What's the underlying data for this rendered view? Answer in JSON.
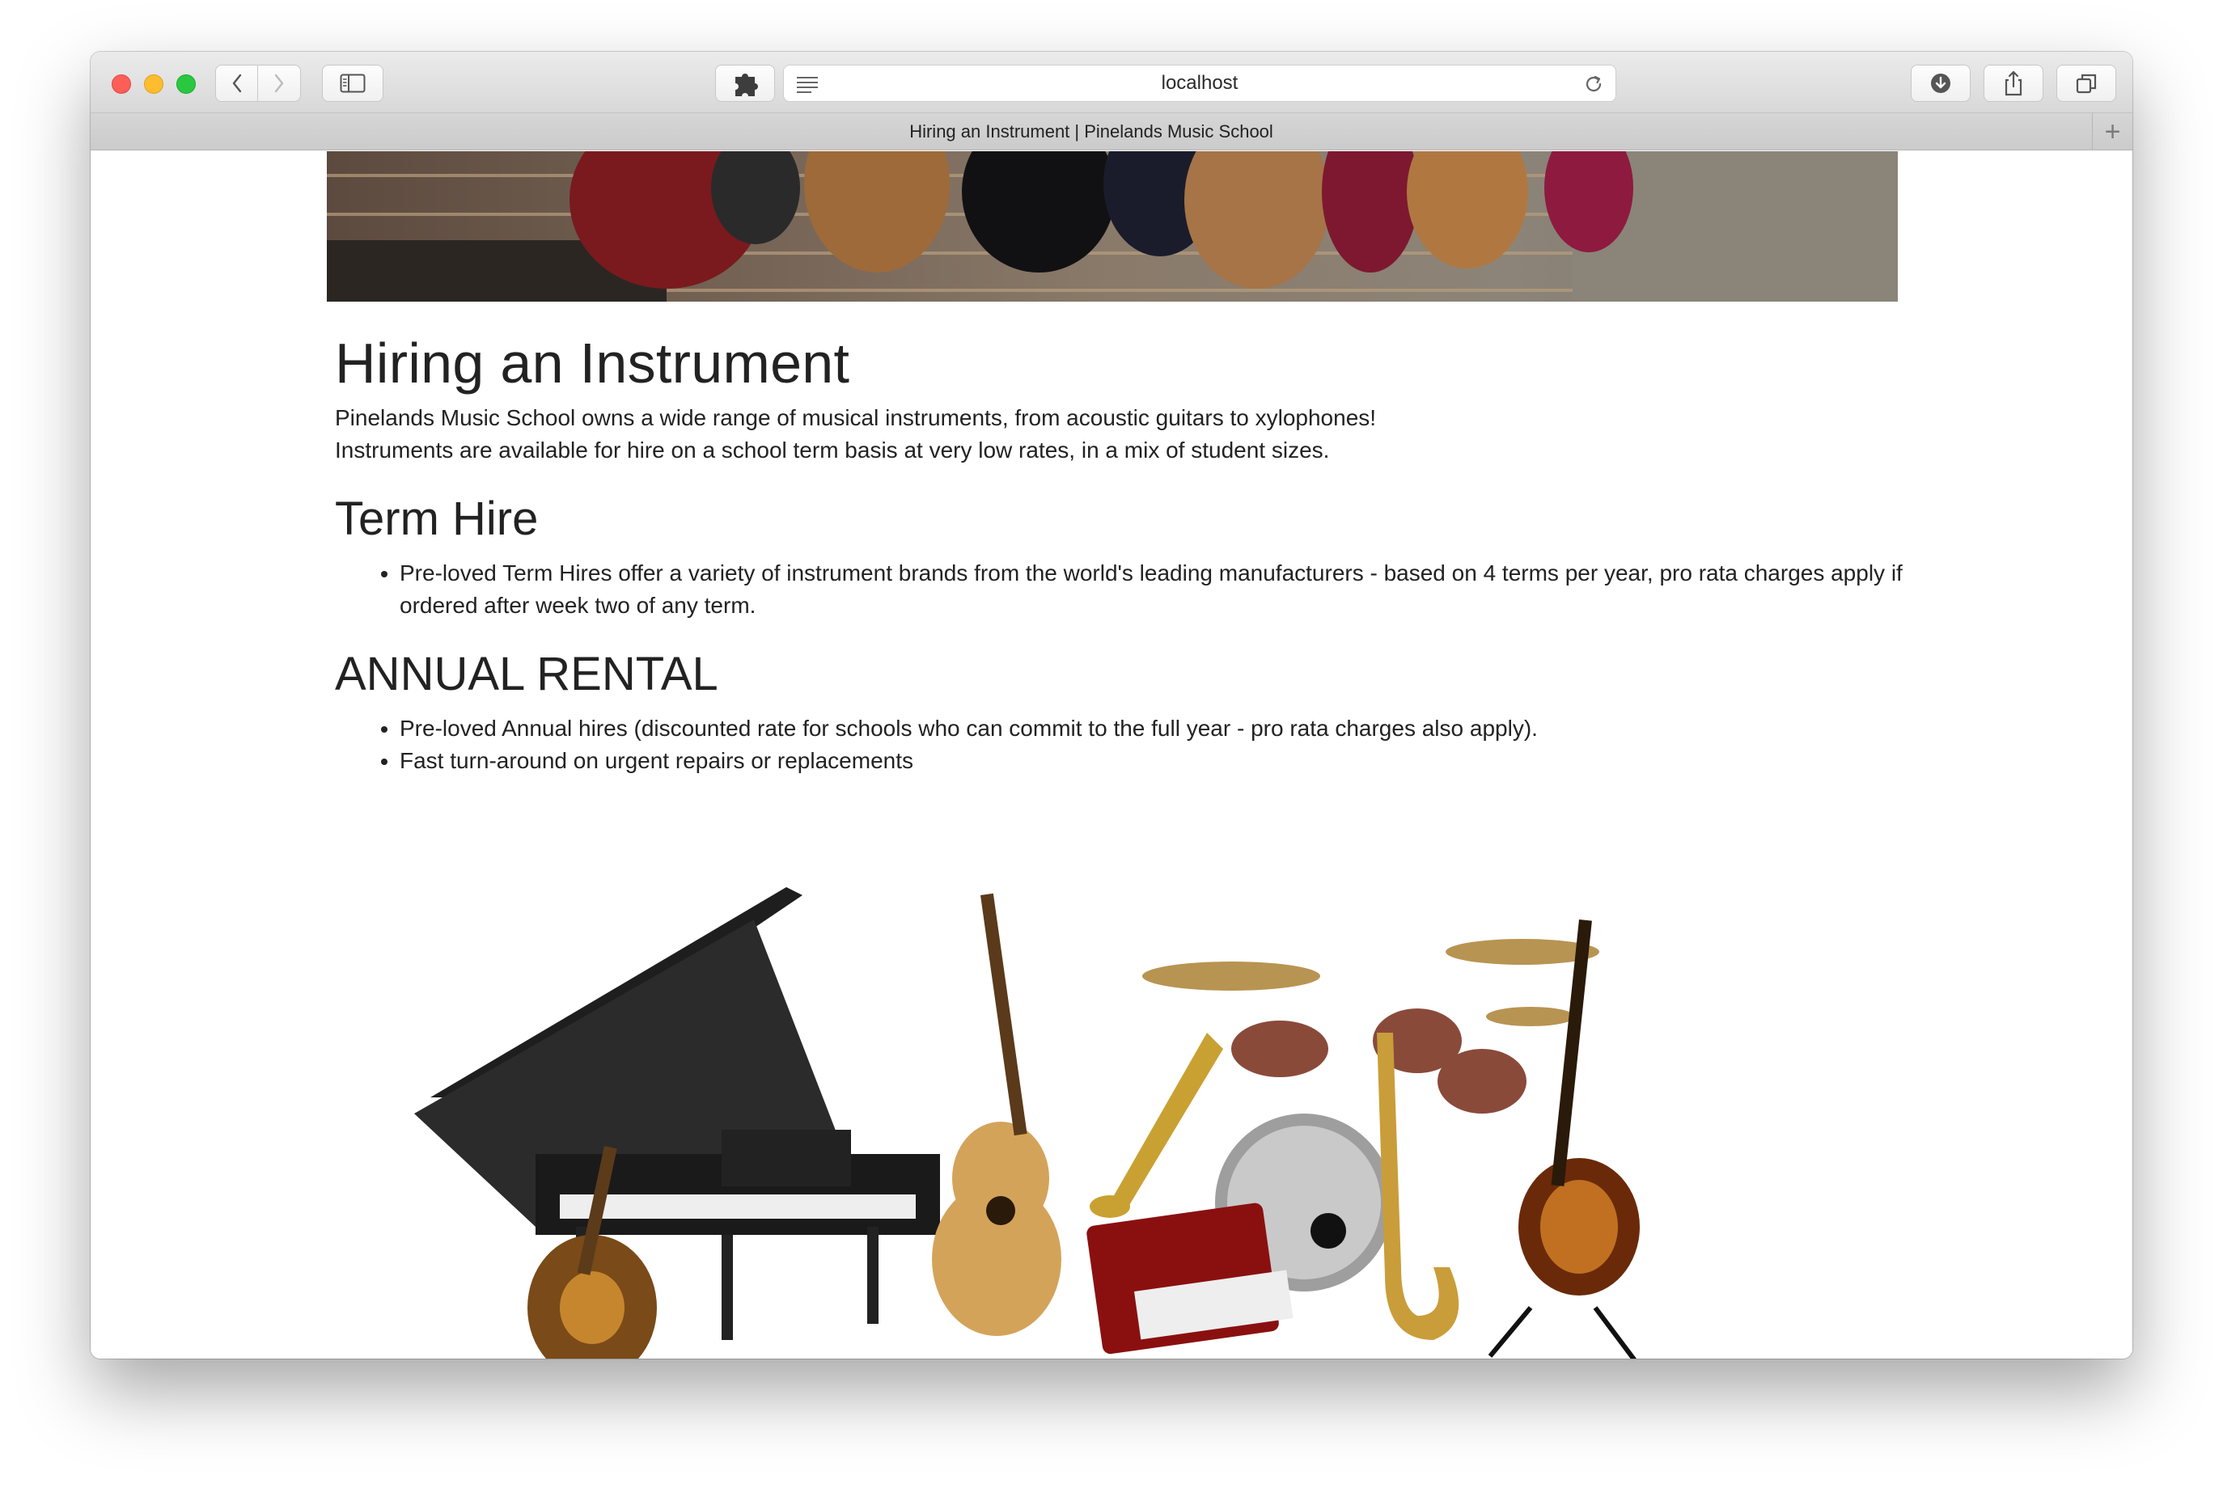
{
  "browser": {
    "url": "localhost",
    "tab_title": "Hiring an Instrument | Pinelands Music School",
    "new_tab_symbol": "+"
  },
  "page": {
    "title": "Hiring an Instrument",
    "intro": [
      "Pinelands Music School owns a wide range of musical instruments, from acoustic guitars to xylophones!",
      "Instruments are available for hire on a school term basis at very low rates, in a mix of student sizes."
    ],
    "sections": [
      {
        "heading": "Term Hire",
        "items": [
          "Pre-loved Term Hires offer a variety of instrument brands from the world's leading manufacturers - based on 4 terms per year, pro rata charges apply if ordered after week two of any term."
        ]
      },
      {
        "heading": "ANNUAL RENTAL",
        "items": [
          "Pre-loved Annual hires (discounted rate for schools who can commit to the full year - pro rata charges also apply).",
          "Fast turn-around on urgent repairs or replacements"
        ]
      }
    ]
  },
  "colors": {
    "close": "#fd5e57",
    "minimize": "#febc2e",
    "zoom": "#29c840",
    "text": "#222222"
  },
  "icons": [
    "chevron-left-icon",
    "chevron-right-icon",
    "sidebar-icon",
    "extension-icon",
    "reader-icon",
    "reload-icon",
    "download-icon",
    "share-icon",
    "tabs-overview-icon"
  ]
}
